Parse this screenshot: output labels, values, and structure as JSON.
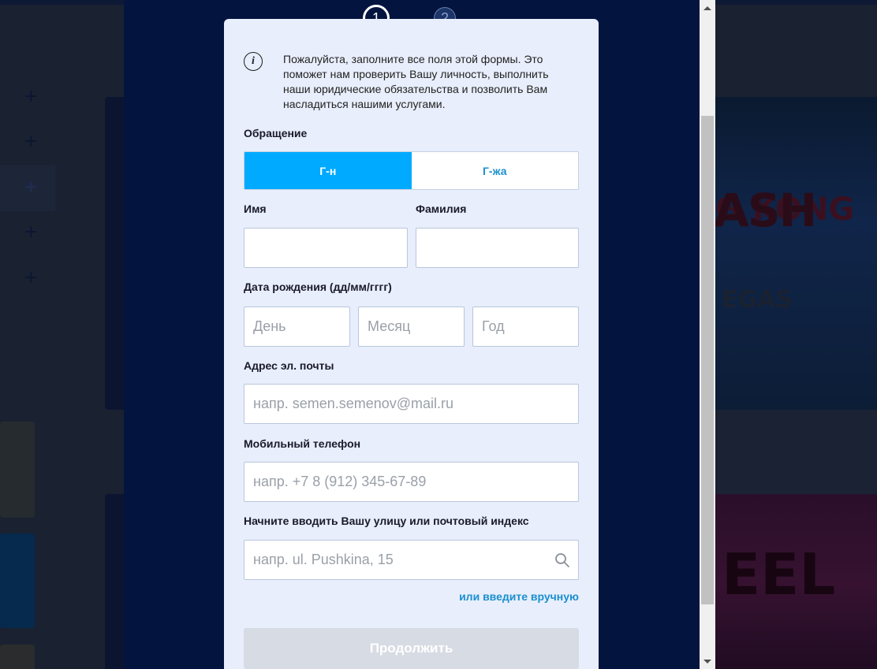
{
  "steps": [
    "1",
    "2"
  ],
  "form": {
    "info_text": "Пожалуйста, заполните все поля этой формы. Это поможет нам проверить Вашу личность, выполнить наши юридические обязательства и позволить Вам насладиться нашими услугами.",
    "salutation_label": "Обращение",
    "salutation_options": [
      "Г-н",
      "Г-жа"
    ],
    "salutation_selected": "Г-н",
    "first_name_label": "Имя",
    "first_name_value": "",
    "last_name_label": "Фамилия",
    "last_name_value": "",
    "dob_label": "Дата рождения (дд/мм/гггг)",
    "dob_day_placeholder": "День",
    "dob_month_placeholder": "Месяц",
    "dob_year_placeholder": "Год",
    "email_label": "Адрес эл. почты",
    "email_placeholder": "напр. semen.semenov@mail.ru",
    "phone_label": "Мобильный телефон",
    "phone_placeholder": "напр. +7 8 (912) 345-67-89",
    "address_label": "Начните вводить Вашу улицу или почтовый индекс",
    "address_placeholder": "напр. ul. Pushkina, 15",
    "manual_link": "или введите вручную",
    "continue_label": "Продолжить"
  },
  "colors": {
    "accent": "#00aaff",
    "link": "#1a8fd0",
    "modal_bg": "#03143f",
    "card_bg": "#e8eefb",
    "disabled_button": "#d7dbe3"
  },
  "icons": [
    "info-icon",
    "search-icon",
    "plus-icon",
    "scroll-up-arrow-icon",
    "scroll-down-arrow-icon"
  ]
}
